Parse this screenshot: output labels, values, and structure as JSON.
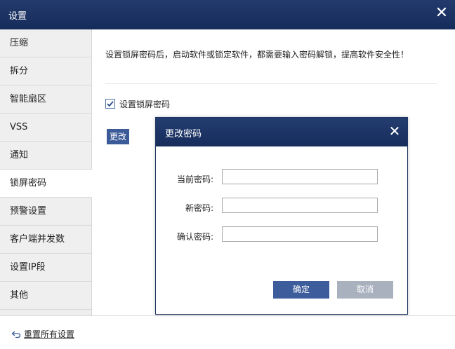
{
  "window": {
    "title": "设置"
  },
  "sidebar": {
    "items": [
      {
        "label": "压缩"
      },
      {
        "label": "拆分"
      },
      {
        "label": "智能扇区"
      },
      {
        "label": "VSS"
      },
      {
        "label": "通知"
      },
      {
        "label": "锁屏密码",
        "active": true
      },
      {
        "label": "预警设置"
      },
      {
        "label": "客户端并发数"
      },
      {
        "label": "设置IP段"
      },
      {
        "label": "其他"
      }
    ]
  },
  "main": {
    "description": "设置锁屏密码后，启动软件或锁定软件，都需要输入密码解锁，提高软件安全性！",
    "checkbox_label": "设置锁屏密码",
    "checkbox_checked": true,
    "change_button": "更改"
  },
  "footer": {
    "reset_label": "重置所有设置"
  },
  "dialog": {
    "title": "更改密码",
    "fields": {
      "current": {
        "label": "当前密码:",
        "value": ""
      },
      "new": {
        "label": "新密码:",
        "value": ""
      },
      "confirm": {
        "label": "确认密码:",
        "value": ""
      }
    },
    "ok_button": "确定",
    "cancel_button": "取消"
  },
  "colors": {
    "titlebar": "#1b3263",
    "primary_button": "#3d5c9b",
    "disabled_button": "#a9b1bf",
    "sidebar_bg": "#efefef"
  }
}
